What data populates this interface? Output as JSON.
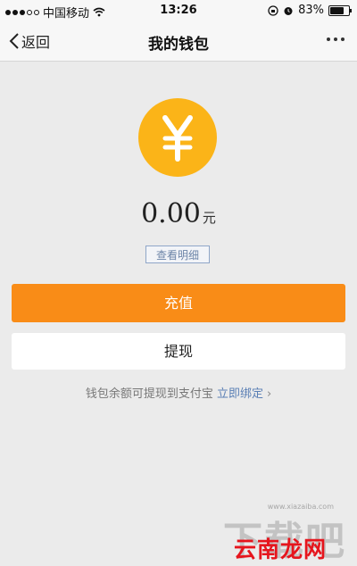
{
  "status_bar": {
    "carrier": "中国移动",
    "time": "13:26",
    "battery": "83%",
    "battery_level": 0.83
  },
  "nav": {
    "back_label": "返回",
    "title": "我的钱包"
  },
  "wallet": {
    "currency_symbol": "¥",
    "amount": "0.00",
    "unit": "元",
    "detail_label": "查看明细"
  },
  "actions": {
    "recharge_label": "充值",
    "withdraw_label": "提现"
  },
  "note": {
    "text": "钱包余额可提现到支付宝",
    "link": "立即绑定",
    "chevron": "›"
  },
  "watermark": {
    "big": "下载吧",
    "small": "www.xiazaiba.com",
    "red": "云南龙网"
  },
  "colors": {
    "accent_orange": "#f98c17",
    "coin_yellow": "#fbb418",
    "link_blue": "#5a7fb5",
    "watermark_red": "#e6151d"
  }
}
